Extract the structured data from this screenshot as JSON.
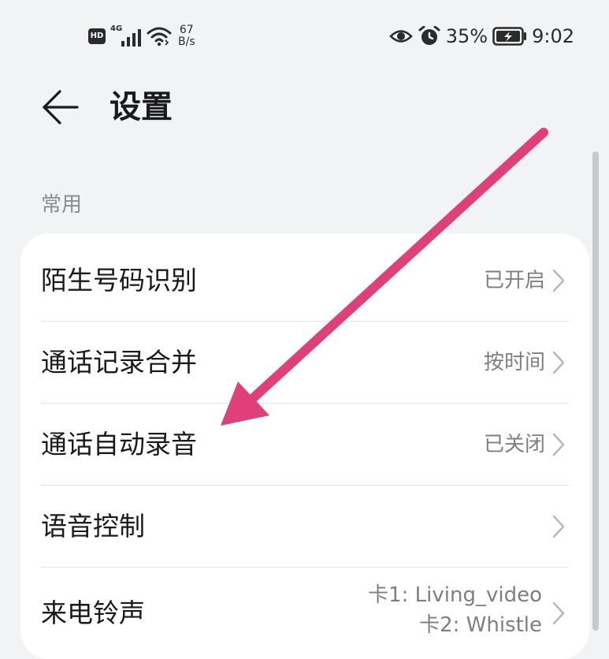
{
  "status_bar": {
    "hd_badge": "HD",
    "network_type": "4G",
    "net_speed_value": "67",
    "net_speed_unit": "B/s",
    "battery_percent": "35%",
    "time": "9:02",
    "icons": [
      "hd-icon",
      "cellular-signal-icon",
      "wifi-icon",
      "eye-comfort-icon",
      "alarm-icon",
      "battery-charging-icon"
    ]
  },
  "header": {
    "title": "设置",
    "back_icon": "back-arrow-icon"
  },
  "section": {
    "label": "常用"
  },
  "settings": {
    "items": [
      {
        "title": "陌生号码识别",
        "value": "已开启"
      },
      {
        "title": "通话记录合并",
        "value": "按时间"
      },
      {
        "title": "通话自动录音",
        "value": "已关闭"
      },
      {
        "title": "语音控制",
        "value": ""
      },
      {
        "title": "来电铃声",
        "value_lines": [
          "卡1: Living_video",
          "卡2: Whistle"
        ]
      }
    ]
  },
  "colors": {
    "background": "#f1f3f5",
    "card": "#ffffff",
    "primary_text": "#1a1a1a",
    "secondary_text": "#7d7f83",
    "annotation_arrow": "#e0407a"
  }
}
